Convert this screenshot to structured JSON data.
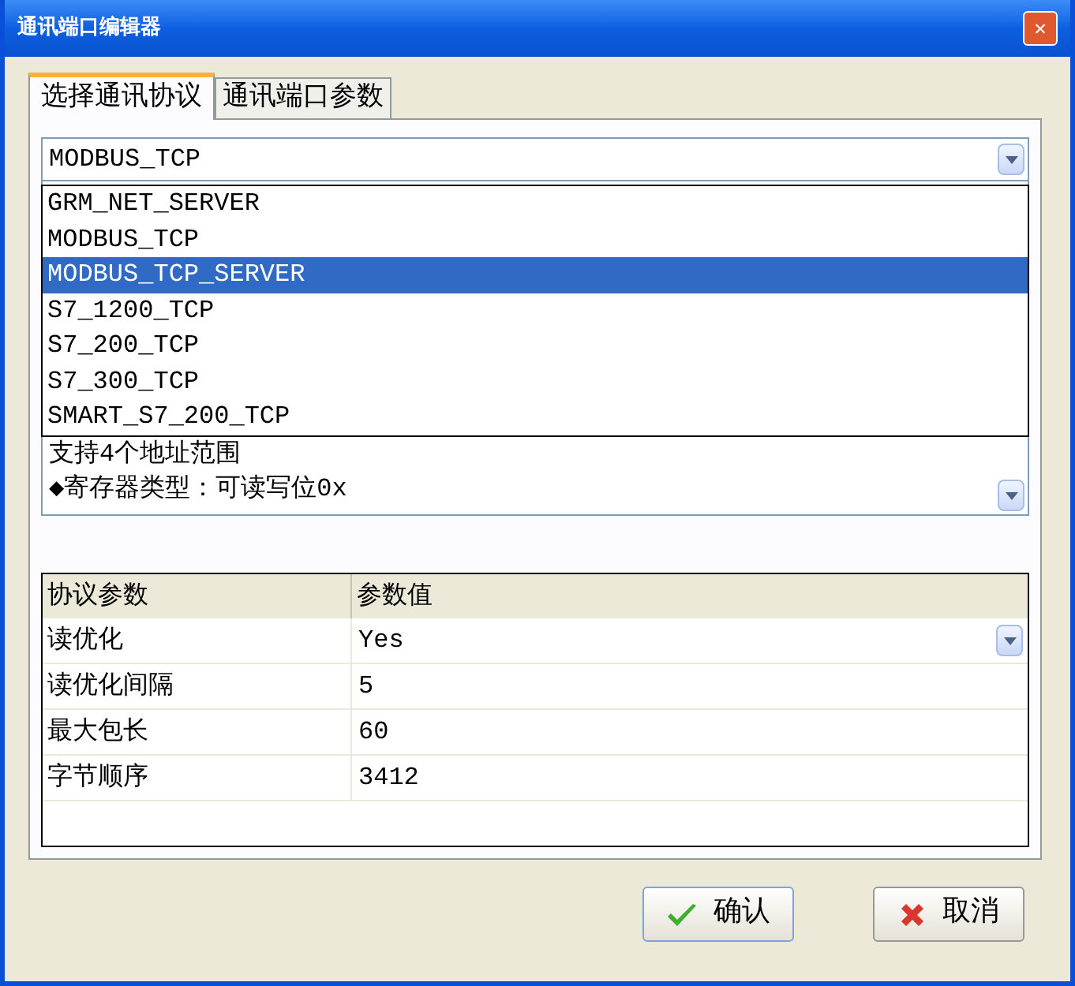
{
  "window": {
    "title": "通讯端口编辑器",
    "close": "✕"
  },
  "tabs": [
    {
      "label": "选择通讯协议",
      "selected": true
    },
    {
      "label": "通讯端口参数",
      "selected": false
    }
  ],
  "protocol_select": {
    "value": "MODBUS_TCP",
    "expanded": true,
    "options": [
      {
        "label": "GRM_NET_SERVER",
        "highlighted": false
      },
      {
        "label": "MODBUS_TCP",
        "highlighted": false
      },
      {
        "label": "MODBUS_TCP_SERVER",
        "highlighted": true
      },
      {
        "label": "S7_1200_TCP",
        "highlighted": false
      },
      {
        "label": "S7_200_TCP",
        "highlighted": false
      },
      {
        "label": "S7_300_TCP",
        "highlighted": false
      },
      {
        "label": "SMART_S7_200_TCP",
        "highlighted": false
      }
    ]
  },
  "description": [
    "支持4个地址范围",
    "◆寄存器类型：可读写位0x"
  ],
  "table": {
    "columns": [
      "协议参数",
      "参数值"
    ],
    "rows": [
      {
        "name": "读优化",
        "value": "Yes",
        "kind": "dropdown"
      },
      {
        "name": "读优化间隔",
        "value": "5",
        "kind": "text"
      },
      {
        "name": "最大包长",
        "value": "60",
        "kind": "text"
      },
      {
        "name": "字节顺序",
        "value": "3412",
        "kind": "text"
      }
    ]
  },
  "buttons": [
    {
      "label": "确认",
      "kind": "ok"
    },
    {
      "label": "取消",
      "kind": "cancel"
    }
  ]
}
